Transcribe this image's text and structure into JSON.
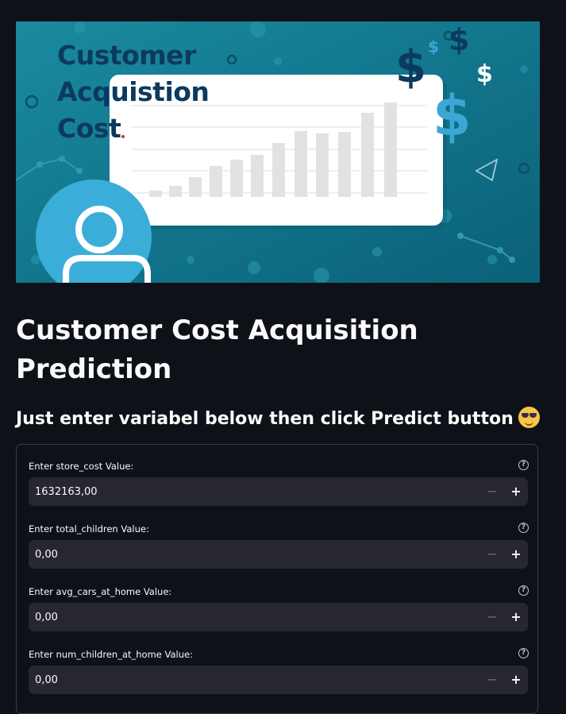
{
  "banner": {
    "title_lines": [
      "Customer",
      "Acquistion",
      "Cost"
    ],
    "dollar_symbol": "$",
    "colors": {
      "background": "#0d6b7e",
      "title": "#0c3a5e",
      "accent": "#3ca6d4"
    }
  },
  "page": {
    "title": "Customer Cost Acquisition Prediction",
    "subtitle": "Just enter variabel below then click Predict button",
    "subtitle_emoji": "smiling-face-with-sunglasses-icon"
  },
  "form": {
    "help_glyph": "?",
    "minus_glyph": "−",
    "plus_glyph": "+",
    "fields": [
      {
        "label": "Enter store_cost Value:",
        "value": "1632163,00"
      },
      {
        "label": "Enter total_children Value:",
        "value": "0,00"
      },
      {
        "label": "Enter avg_cars_at_home Value:",
        "value": "0,00"
      },
      {
        "label": "Enter num_children_at_home Value:",
        "value": "0,00"
      }
    ]
  },
  "theme": {
    "background": "#0e1117",
    "input_bg": "#262730",
    "text": "#fafafa"
  }
}
